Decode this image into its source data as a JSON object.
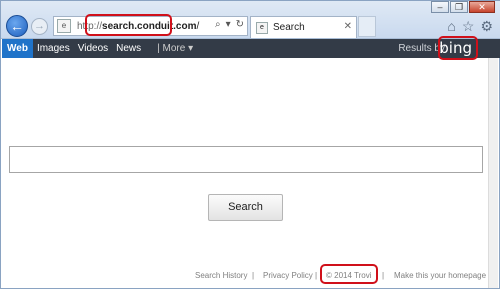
{
  "window": {
    "minimize": "–",
    "restore": "❐",
    "close": "✕"
  },
  "nav": {
    "back_icon": "←",
    "forward_icon": "→"
  },
  "address": {
    "prefix": "http://",
    "url_bold": "search.conduit.com",
    "url_suffix": "/",
    "search_glyph": "⌕",
    "dropdown_glyph": "▾",
    "refresh_glyph": "↻"
  },
  "tab": {
    "label": "Search",
    "close": "✕"
  },
  "toolbar": {
    "home_icon": "⌂",
    "favorites_icon": "☆",
    "settings_icon": "⚙"
  },
  "navbar": {
    "items": [
      "Web",
      "Images",
      "Videos",
      "News"
    ],
    "more": "| More ▾",
    "results_by": "Results by",
    "bing": "bing"
  },
  "search": {
    "button": "Search"
  },
  "footer": {
    "links": [
      "Search History",
      "|",
      "Privacy Policy",
      "|",
      "© 2014 Trovi",
      "|",
      "Make this your homepage"
    ]
  },
  "colors": {
    "navbar_bg": "#333b47",
    "active_tab": "#1f73c9",
    "highlight": "#d0101a"
  }
}
